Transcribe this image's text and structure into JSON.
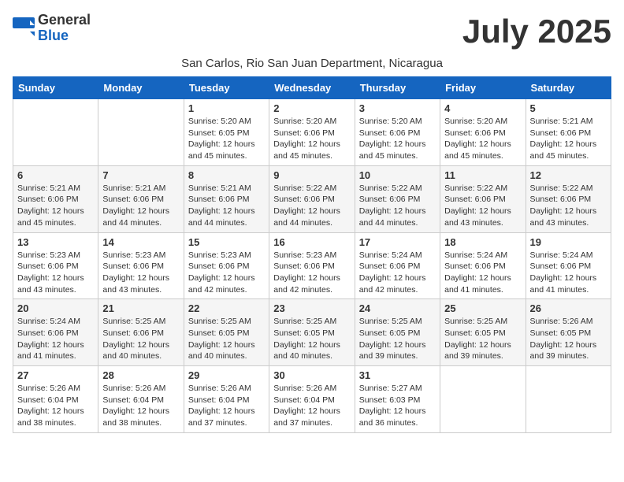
{
  "logo": {
    "general": "General",
    "blue": "Blue"
  },
  "title": "July 2025",
  "subtitle": "San Carlos, Rio San Juan Department, Nicaragua",
  "weekdays": [
    "Sunday",
    "Monday",
    "Tuesday",
    "Wednesday",
    "Thursday",
    "Friday",
    "Saturday"
  ],
  "weeks": [
    [
      {
        "day": null
      },
      {
        "day": null
      },
      {
        "day": "1",
        "sunrise": "Sunrise: 5:20 AM",
        "sunset": "Sunset: 6:05 PM",
        "daylight": "Daylight: 12 hours and 45 minutes."
      },
      {
        "day": "2",
        "sunrise": "Sunrise: 5:20 AM",
        "sunset": "Sunset: 6:06 PM",
        "daylight": "Daylight: 12 hours and 45 minutes."
      },
      {
        "day": "3",
        "sunrise": "Sunrise: 5:20 AM",
        "sunset": "Sunset: 6:06 PM",
        "daylight": "Daylight: 12 hours and 45 minutes."
      },
      {
        "day": "4",
        "sunrise": "Sunrise: 5:20 AM",
        "sunset": "Sunset: 6:06 PM",
        "daylight": "Daylight: 12 hours and 45 minutes."
      },
      {
        "day": "5",
        "sunrise": "Sunrise: 5:21 AM",
        "sunset": "Sunset: 6:06 PM",
        "daylight": "Daylight: 12 hours and 45 minutes."
      }
    ],
    [
      {
        "day": "6",
        "sunrise": "Sunrise: 5:21 AM",
        "sunset": "Sunset: 6:06 PM",
        "daylight": "Daylight: 12 hours and 45 minutes."
      },
      {
        "day": "7",
        "sunrise": "Sunrise: 5:21 AM",
        "sunset": "Sunset: 6:06 PM",
        "daylight": "Daylight: 12 hours and 44 minutes."
      },
      {
        "day": "8",
        "sunrise": "Sunrise: 5:21 AM",
        "sunset": "Sunset: 6:06 PM",
        "daylight": "Daylight: 12 hours and 44 minutes."
      },
      {
        "day": "9",
        "sunrise": "Sunrise: 5:22 AM",
        "sunset": "Sunset: 6:06 PM",
        "daylight": "Daylight: 12 hours and 44 minutes."
      },
      {
        "day": "10",
        "sunrise": "Sunrise: 5:22 AM",
        "sunset": "Sunset: 6:06 PM",
        "daylight": "Daylight: 12 hours and 44 minutes."
      },
      {
        "day": "11",
        "sunrise": "Sunrise: 5:22 AM",
        "sunset": "Sunset: 6:06 PM",
        "daylight": "Daylight: 12 hours and 43 minutes."
      },
      {
        "day": "12",
        "sunrise": "Sunrise: 5:22 AM",
        "sunset": "Sunset: 6:06 PM",
        "daylight": "Daylight: 12 hours and 43 minutes."
      }
    ],
    [
      {
        "day": "13",
        "sunrise": "Sunrise: 5:23 AM",
        "sunset": "Sunset: 6:06 PM",
        "daylight": "Daylight: 12 hours and 43 minutes."
      },
      {
        "day": "14",
        "sunrise": "Sunrise: 5:23 AM",
        "sunset": "Sunset: 6:06 PM",
        "daylight": "Daylight: 12 hours and 43 minutes."
      },
      {
        "day": "15",
        "sunrise": "Sunrise: 5:23 AM",
        "sunset": "Sunset: 6:06 PM",
        "daylight": "Daylight: 12 hours and 42 minutes."
      },
      {
        "day": "16",
        "sunrise": "Sunrise: 5:23 AM",
        "sunset": "Sunset: 6:06 PM",
        "daylight": "Daylight: 12 hours and 42 minutes."
      },
      {
        "day": "17",
        "sunrise": "Sunrise: 5:24 AM",
        "sunset": "Sunset: 6:06 PM",
        "daylight": "Daylight: 12 hours and 42 minutes."
      },
      {
        "day": "18",
        "sunrise": "Sunrise: 5:24 AM",
        "sunset": "Sunset: 6:06 PM",
        "daylight": "Daylight: 12 hours and 41 minutes."
      },
      {
        "day": "19",
        "sunrise": "Sunrise: 5:24 AM",
        "sunset": "Sunset: 6:06 PM",
        "daylight": "Daylight: 12 hours and 41 minutes."
      }
    ],
    [
      {
        "day": "20",
        "sunrise": "Sunrise: 5:24 AM",
        "sunset": "Sunset: 6:06 PM",
        "daylight": "Daylight: 12 hours and 41 minutes."
      },
      {
        "day": "21",
        "sunrise": "Sunrise: 5:25 AM",
        "sunset": "Sunset: 6:06 PM",
        "daylight": "Daylight: 12 hours and 40 minutes."
      },
      {
        "day": "22",
        "sunrise": "Sunrise: 5:25 AM",
        "sunset": "Sunset: 6:05 PM",
        "daylight": "Daylight: 12 hours and 40 minutes."
      },
      {
        "day": "23",
        "sunrise": "Sunrise: 5:25 AM",
        "sunset": "Sunset: 6:05 PM",
        "daylight": "Daylight: 12 hours and 40 minutes."
      },
      {
        "day": "24",
        "sunrise": "Sunrise: 5:25 AM",
        "sunset": "Sunset: 6:05 PM",
        "daylight": "Daylight: 12 hours and 39 minutes."
      },
      {
        "day": "25",
        "sunrise": "Sunrise: 5:25 AM",
        "sunset": "Sunset: 6:05 PM",
        "daylight": "Daylight: 12 hours and 39 minutes."
      },
      {
        "day": "26",
        "sunrise": "Sunrise: 5:26 AM",
        "sunset": "Sunset: 6:05 PM",
        "daylight": "Daylight: 12 hours and 39 minutes."
      }
    ],
    [
      {
        "day": "27",
        "sunrise": "Sunrise: 5:26 AM",
        "sunset": "Sunset: 6:04 PM",
        "daylight": "Daylight: 12 hours and 38 minutes."
      },
      {
        "day": "28",
        "sunrise": "Sunrise: 5:26 AM",
        "sunset": "Sunset: 6:04 PM",
        "daylight": "Daylight: 12 hours and 38 minutes."
      },
      {
        "day": "29",
        "sunrise": "Sunrise: 5:26 AM",
        "sunset": "Sunset: 6:04 PM",
        "daylight": "Daylight: 12 hours and 37 minutes."
      },
      {
        "day": "30",
        "sunrise": "Sunrise: 5:26 AM",
        "sunset": "Sunset: 6:04 PM",
        "daylight": "Daylight: 12 hours and 37 minutes."
      },
      {
        "day": "31",
        "sunrise": "Sunrise: 5:27 AM",
        "sunset": "Sunset: 6:03 PM",
        "daylight": "Daylight: 12 hours and 36 minutes."
      },
      {
        "day": null
      },
      {
        "day": null
      }
    ]
  ]
}
